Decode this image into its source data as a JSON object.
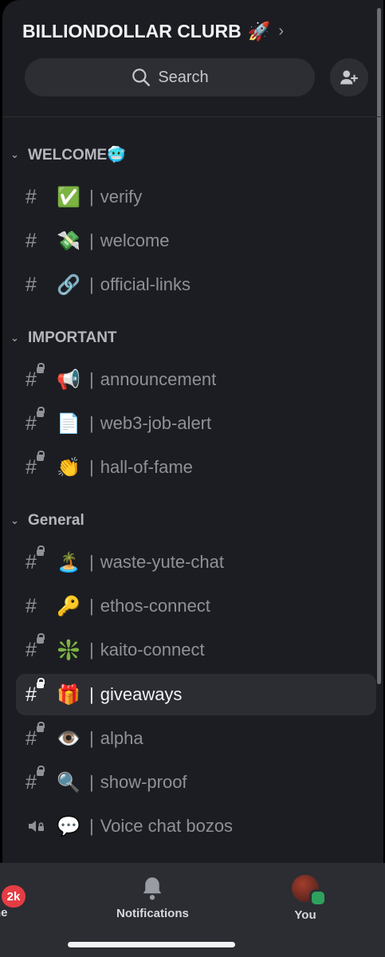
{
  "server": {
    "name": "BILLIONDOLLAR CLURB",
    "emoji": "🚀"
  },
  "search": {
    "label": "Search"
  },
  "categories": [
    {
      "name": "WELCOME🥶"
    },
    {
      "name": "IMPORTANT"
    },
    {
      "name": "General"
    }
  ],
  "channels": [
    {
      "emoji": "✅",
      "name": "verify"
    },
    {
      "emoji": "💸",
      "name": "welcome"
    },
    {
      "emoji": "🔗",
      "name": "official-links"
    },
    {
      "emoji": "📢",
      "name": "announcement"
    },
    {
      "emoji": "📄",
      "name": "web3-job-alert"
    },
    {
      "emoji": "👏",
      "name": "hall-of-fame"
    },
    {
      "emoji": "🏝️",
      "name": "waste-yute-chat"
    },
    {
      "emoji": "🔑",
      "name": "ethos-connect"
    },
    {
      "emoji": "❇️",
      "name": "kaito-connect"
    },
    {
      "emoji": "🎁",
      "name": "giveaways"
    },
    {
      "emoji": "👁️",
      "name": "alpha"
    },
    {
      "emoji": "🔍",
      "name": "show-proof"
    },
    {
      "emoji": "💬",
      "name": "Voice chat bozos"
    }
  ],
  "separator": "|",
  "bottom_nav": {
    "home_label": "ne",
    "home_badge": "2k",
    "notifications_label": "Notifications",
    "you_label": "You"
  },
  "colors": {
    "panel": "#1c1d22",
    "active_row": "#2b2d33",
    "badge": "#e53d44",
    "online": "#2ea15c"
  }
}
